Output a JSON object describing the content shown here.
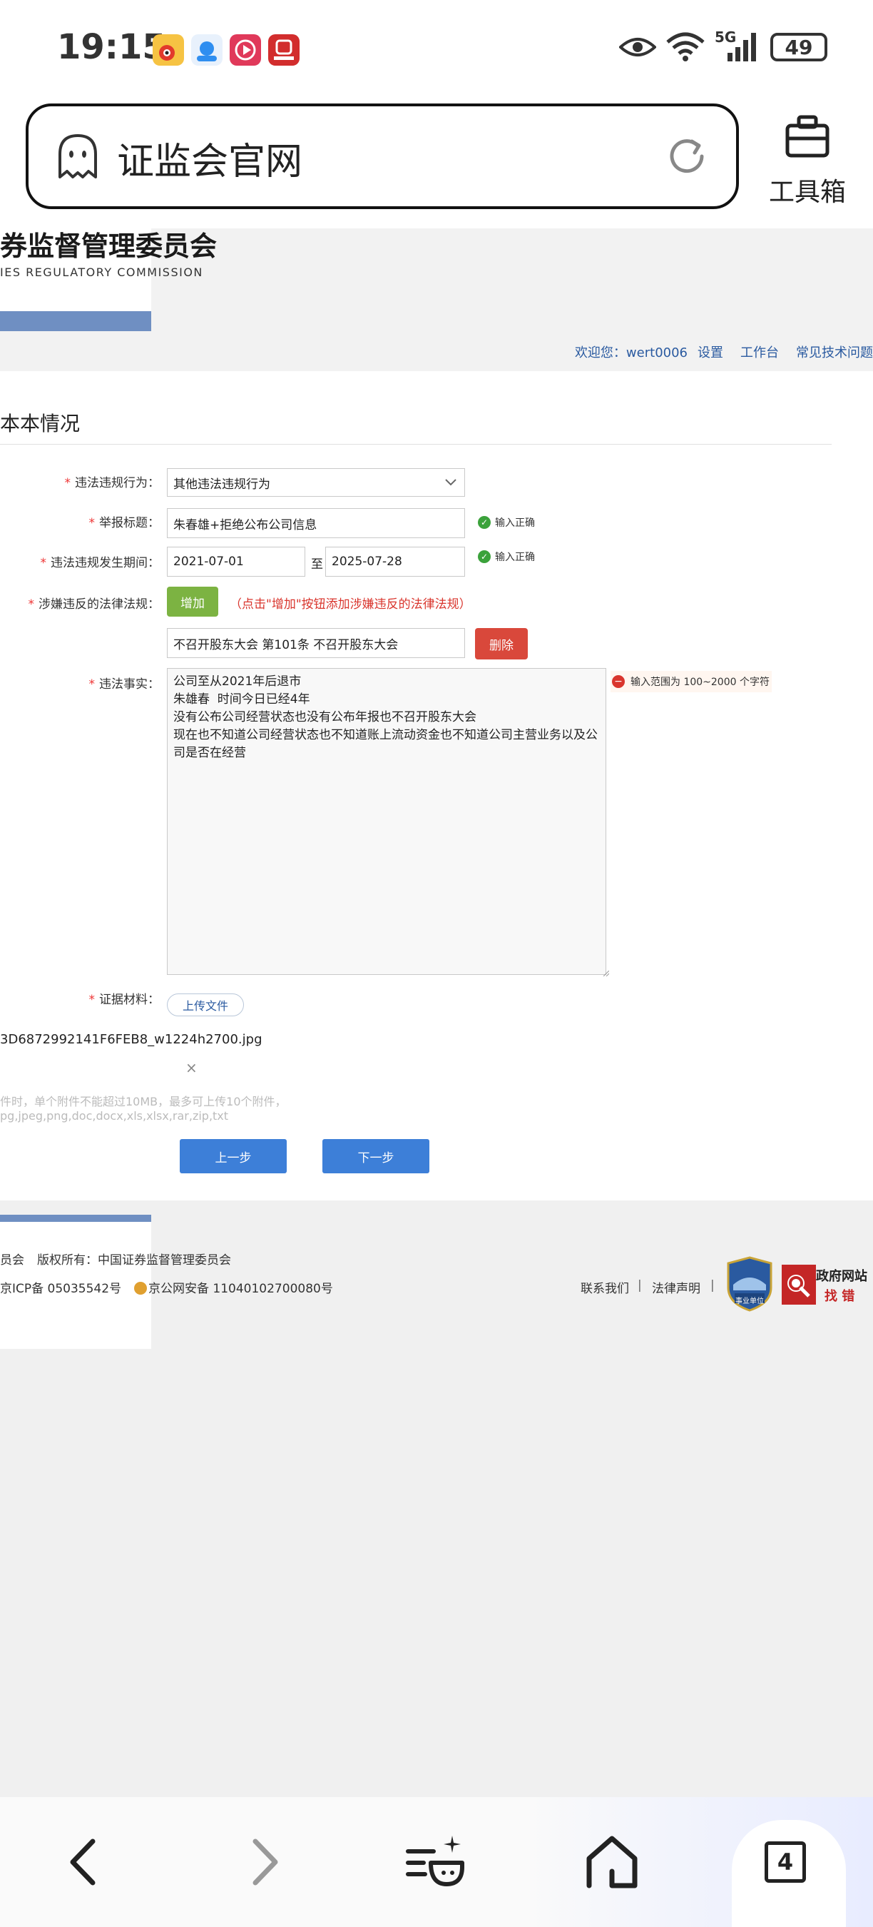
{
  "status_bar": {
    "time": "19:15",
    "battery": "49",
    "network": "5G"
  },
  "browser": {
    "url_title": "证监会官网",
    "toolbox_label": "工具箱"
  },
  "site": {
    "title": "券监督管理委员会",
    "subtitle": "IES REGULATORY COMMISSION",
    "nav": {
      "welcome": "欢迎您：wert0006",
      "settings": "设置",
      "workbench": "工作台",
      "faq": "常见技术问题"
    }
  },
  "form": {
    "section_title": "本本情况",
    "violation_type": {
      "label": "违法违规行为：",
      "value": "其他违法违规行为"
    },
    "report_title": {
      "label": "举报标题：",
      "value": "朱春雄+拒绝公布公司信息",
      "hint": "输入正确"
    },
    "period": {
      "label": "违法违规发生期间：",
      "from": "2021-07-01",
      "sep": "至",
      "to": "2025-07-28",
      "hint": "输入正确"
    },
    "laws": {
      "label": "涉嫌违反的法律法规：",
      "add_button": "增加",
      "add_hint": "（点击\"增加\"按钮添加涉嫌违反的法律法规）",
      "item_value": "不召开股东大会 第101条 不召开股东大会",
      "delete_button": "删除"
    },
    "facts": {
      "label": "违法事实：",
      "value": "公司至从2021年后退市\n朱雄春  时间今日已经4年\n没有公布公司经营状态也没有公布年报也不召开股东大会\n现在也不知道公司经营状态也不知道账上流动资金也不知道公司主营业务以及公司是否在经营",
      "error_hint": "输入范围为 100~2000 个字符"
    },
    "evidence": {
      "label": "证据材料：",
      "upload_button": "上传文件",
      "file_name": "3D6872992141F6FEB8_w1224h2700.jpg",
      "remove": "×",
      "note_1": "件时，单个附件不能超过10MB，最多可上传10个附件，",
      "note_2": "pg,jpeg,png,doc,docx,xls,xlsx,rar,zip,txt"
    },
    "prev_button": "上一步",
    "next_button": "下一步"
  },
  "footer": {
    "host": "员会",
    "copyright": "版权所有：中国证券监督管理委员会",
    "icp": "京ICP备 05035542号",
    "police_record": "京公网安备 11040102700080号",
    "contact": "联系我们",
    "sep": "|",
    "legal": "法律声明",
    "badge_gov": "事业单位",
    "badge_find_1": "政府网站",
    "badge_find_2": "找 错"
  },
  "bottom_nav": {
    "tab_count": "4"
  },
  "colors": {
    "accent_blue": "#3d7fd8",
    "brand_blue": "#6f8fc2",
    "ok_green": "#3ba23b",
    "error_red": "#d9352d"
  }
}
